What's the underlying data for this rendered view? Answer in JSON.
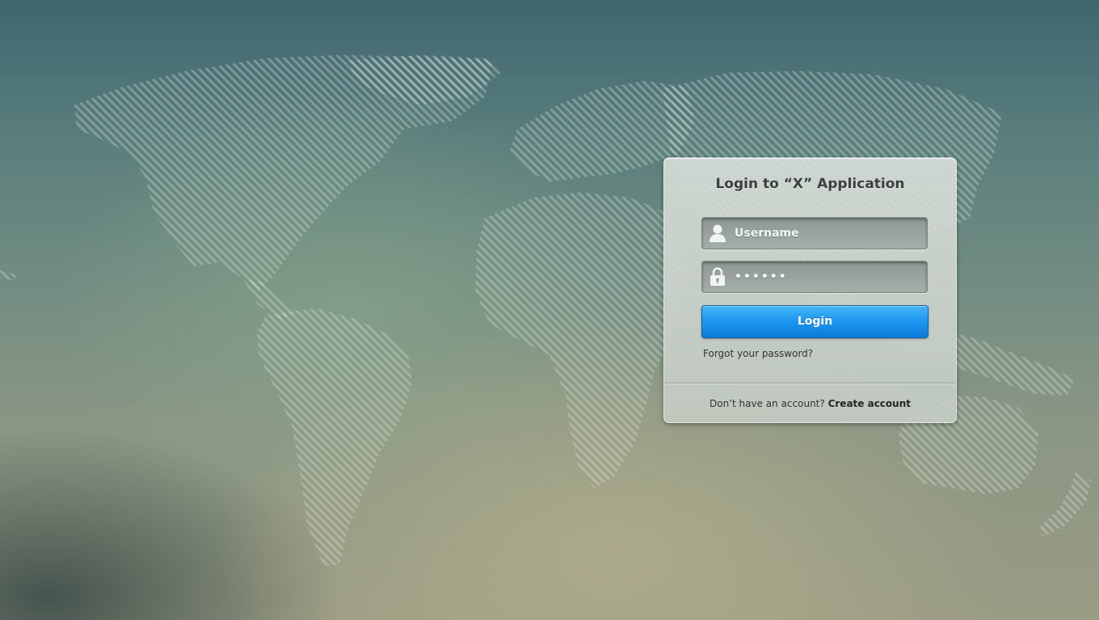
{
  "background": {
    "map_icon": "world-map-dotted",
    "colors": {
      "top": "#3f6670",
      "middle": "#718c82",
      "bottom": "#9a9c84"
    }
  },
  "login_panel": {
    "title": "Login to “X” Application",
    "username": {
      "icon": "user-icon",
      "placeholder": "Username",
      "value": ""
    },
    "password": {
      "icon": "lock-icon",
      "masked_value": "••••••"
    },
    "login_button_label": "Login",
    "forgot_password_label": "Forgot your password?",
    "signup_prompt": "Don’t have an account?",
    "create_account_label": "Create account",
    "colors": {
      "button": "#1b96ef",
      "panel": "#cfd6cf"
    }
  }
}
